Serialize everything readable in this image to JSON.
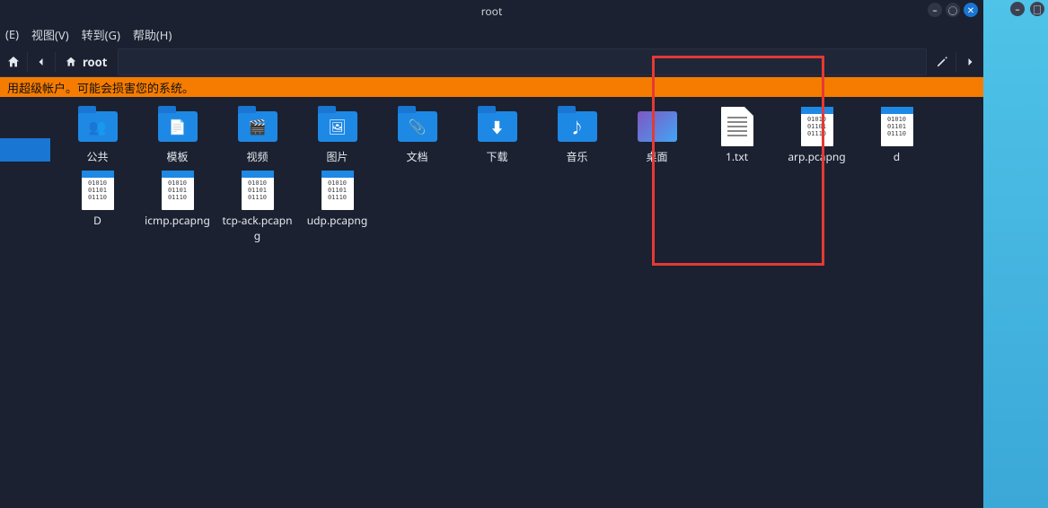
{
  "title": "root",
  "menu": {
    "e": "(E)",
    "view": "视图(V)",
    "goto": "转到(G)",
    "help": "帮助(H)"
  },
  "toolbar": {
    "path": "root"
  },
  "warning": "用超级帐户。可能会损害您的系统。",
  "items": [
    {
      "label": "公共",
      "kind": "folder",
      "glyph": "👥"
    },
    {
      "label": "模板",
      "kind": "folder",
      "glyph": "📄"
    },
    {
      "label": "视频",
      "kind": "folder",
      "glyph": "🎬"
    },
    {
      "label": "图片",
      "kind": "folder",
      "glyph": "🖼"
    },
    {
      "label": "文档",
      "kind": "folder",
      "glyph": "📎"
    },
    {
      "label": "下载",
      "kind": "folder",
      "glyph": "⬇"
    },
    {
      "label": "音乐",
      "kind": "folder",
      "glyph": "♪"
    },
    {
      "label": "桌面",
      "kind": "desktop",
      "glyph": ""
    },
    {
      "label": "1.txt",
      "kind": "txt",
      "glyph": ""
    },
    {
      "label": "arp.pcapng",
      "kind": "bin",
      "glyph": ""
    },
    {
      "label": "d",
      "kind": "bin",
      "glyph": ""
    },
    {
      "label": "D",
      "kind": "bin",
      "glyph": ""
    },
    {
      "label": "icmp.pcapng",
      "kind": "bin",
      "glyph": ""
    },
    {
      "label": "tcp-ack.pcapng",
      "kind": "bin",
      "glyph": ""
    },
    {
      "label": "udp.pcapng",
      "kind": "bin",
      "glyph": ""
    }
  ]
}
